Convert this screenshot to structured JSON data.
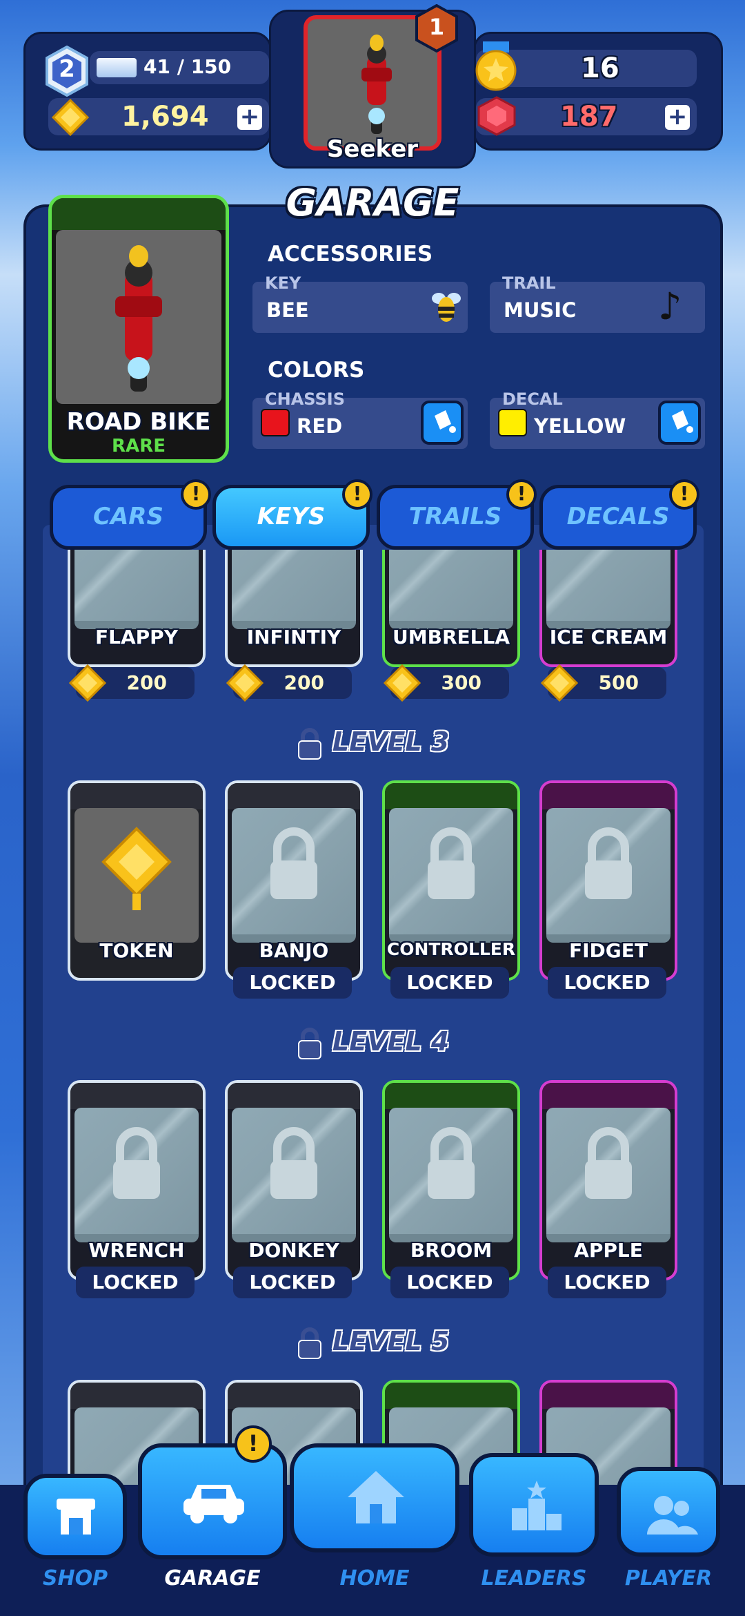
{
  "header": {
    "level": "2",
    "xp_text": "41 / 150",
    "coins": "1,694",
    "medals": "16",
    "gems": "187",
    "profile_name": "Seeker",
    "notification_count": "1"
  },
  "garage": {
    "title": "GARAGE",
    "vehicle_name": "ROAD BIKE",
    "vehicle_rarity": "RARE",
    "accessories_title": "ACCESSORIES",
    "key_label": "KEY",
    "key_value": "BEE",
    "trail_label": "TRAIL",
    "trail_value": "MUSIC",
    "colors_title": "COLORS",
    "chassis_label": "CHASSIS",
    "chassis_value": "RED",
    "chassis_color": "#e8141c",
    "decal_label": "DECAL",
    "decal_value": "YELLOW",
    "decal_color": "#ffee00"
  },
  "tabs": [
    {
      "label": "CARS",
      "badge": "!"
    },
    {
      "label": "KEYS",
      "badge": "!"
    },
    {
      "label": "TRAILS",
      "badge": "!"
    },
    {
      "label": "DECALS",
      "badge": "!"
    }
  ],
  "row1": [
    {
      "name": "FLAPPY",
      "price": "200"
    },
    {
      "name": "INFINTIY",
      "price": "200"
    },
    {
      "name": "UMBRELLA",
      "price": "300"
    },
    {
      "name": "ICE CREAM",
      "price": "500"
    }
  ],
  "level3": {
    "label": "LEVEL 3",
    "items": [
      {
        "name": "TOKEN",
        "status": ""
      },
      {
        "name": "BANJO",
        "status": "LOCKED"
      },
      {
        "name": "CONTROLLER",
        "status": "LOCKED"
      },
      {
        "name": "FIDGET",
        "status": "LOCKED"
      }
    ]
  },
  "level4": {
    "label": "LEVEL 4",
    "items": [
      {
        "name": "WRENCH",
        "status": "LOCKED"
      },
      {
        "name": "DONKEY",
        "status": "LOCKED"
      },
      {
        "name": "BROOM",
        "status": "LOCKED"
      },
      {
        "name": "APPLE",
        "status": "LOCKED"
      }
    ]
  },
  "level5": {
    "label": "LEVEL 5"
  },
  "nav": {
    "shop": "SHOP",
    "garage": "GARAGE",
    "home": "HOME",
    "leaders": "LEADERS",
    "player": "PLAYER",
    "garage_badge": "!"
  }
}
